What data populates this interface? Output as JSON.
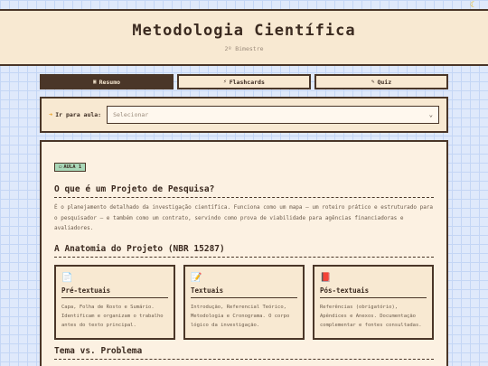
{
  "header": {
    "title": "Metodologia Científica",
    "subtitle": "2º Bimestre",
    "theme_icon": "moon-icon"
  },
  "tabs": [
    {
      "icon": "▣",
      "label": "Resumo",
      "active": true
    },
    {
      "icon": "⚡",
      "label": "Flashcards",
      "active": false
    },
    {
      "icon": "✎",
      "label": "Quiz",
      "active": false
    }
  ],
  "lesson_picker": {
    "label": "Ir para aula:",
    "placeholder": "Selecionar"
  },
  "content": {
    "badge": {
      "icon": "▭",
      "label": "AULA 1"
    },
    "section1": {
      "title": "O que é um Projeto de Pesquisa?",
      "text": "É o planejamento detalhado da investigação científica. Funciona como um mapa — um roteiro prático e estruturado para o pesquisador — e também como um contrato, servindo como prova de viabilidade para agências financiadoras e avaliadores."
    },
    "section2": {
      "title": "A Anatomia do Projeto (NBR 15287)",
      "cards": [
        {
          "icon": "📄",
          "title": "Pré-textuais",
          "text": "Capa, Folha de Rosto e Sumário. Identificam e organizam o trabalho antes do texto principal."
        },
        {
          "icon": "📝",
          "title": "Textuais",
          "text": "Introdução, Referencial Teórico, Metodologia e Cronograma. O corpo lógico da investigação."
        },
        {
          "icon": "📕",
          "title": "Pós-textuais",
          "text": "Referências (obrigatório), Apêndices e Anexos. Documentação complementar e fontes consultadas."
        }
      ]
    },
    "section3": {
      "title": "Tema vs. Problema"
    }
  },
  "colors": {
    "accent_dark": "#4a3628",
    "panel": "#f8e9d2",
    "badge": "#a9d8b8",
    "background_grid": "#dfe9fb"
  }
}
